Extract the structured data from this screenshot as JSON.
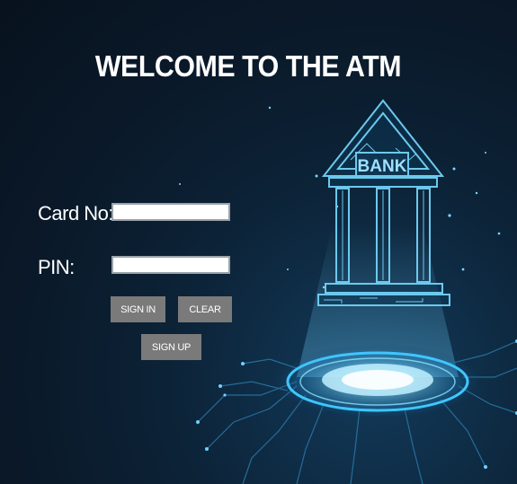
{
  "window": {
    "title": "WELCOME TO THE ATM"
  },
  "form": {
    "card_label": "Card No:",
    "card_value": "",
    "pin_label": "PIN:",
    "pin_value": ""
  },
  "buttons": {
    "sign_in": "SIGN IN",
    "clear": "CLEAR",
    "sign_up": "SIGN UP"
  },
  "illustration": {
    "bank_sign": "BANK",
    "icon": "bank-icon"
  },
  "colors": {
    "background": "#0a1828",
    "glow": "#3fc6ff",
    "button": "#7a7a7a"
  }
}
